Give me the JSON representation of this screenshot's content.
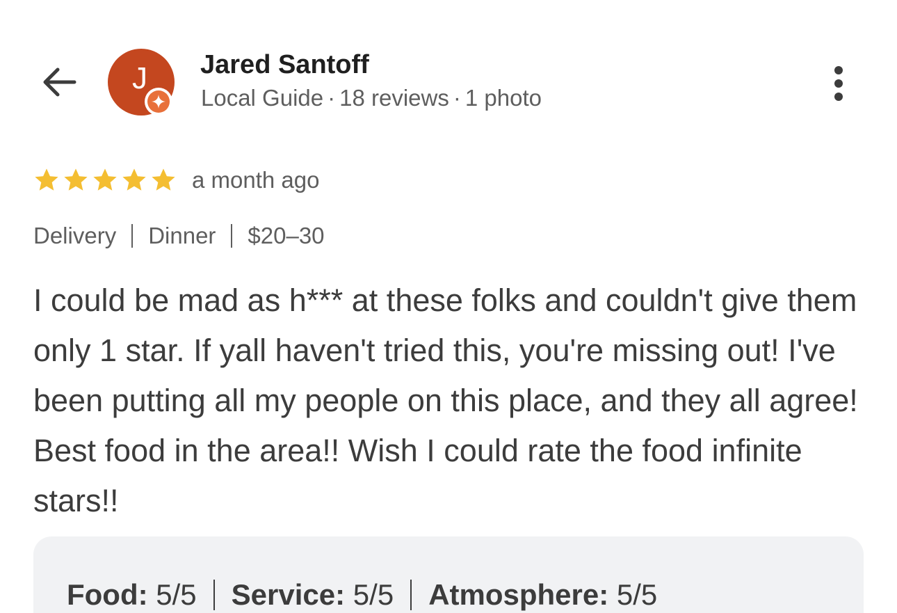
{
  "header": {
    "back_icon": "arrow-left-icon",
    "avatar_letter": "J",
    "avatar_color": "#c4471f",
    "badge_icon": "local-guide-star-icon",
    "badge_color": "#e8703a",
    "name": "Jared Santoff",
    "meta": {
      "status": "Local Guide",
      "reviews": "18 reviews",
      "photos": "1 photo",
      "separator": "·"
    },
    "more_icon": "more-vertical-icon"
  },
  "review": {
    "rating": 5,
    "rating_max": 5,
    "star_color": "#f4be32",
    "time": "a month ago",
    "attributes": [
      "Delivery",
      "Dinner",
      "$20–30"
    ],
    "text": "I could be mad as h*** at these folks and couldn't give them only 1 star. If yall haven't tried this, you're missing out! I've been putting all my people on this place, and they all agree! Best food in the area!! Wish I could rate the food infinite stars!!"
  },
  "ratings": [
    {
      "label": "Food:",
      "value": "5/5"
    },
    {
      "label": "Service:",
      "value": "5/5"
    },
    {
      "label": "Atmosphere:",
      "value": "5/5"
    }
  ]
}
